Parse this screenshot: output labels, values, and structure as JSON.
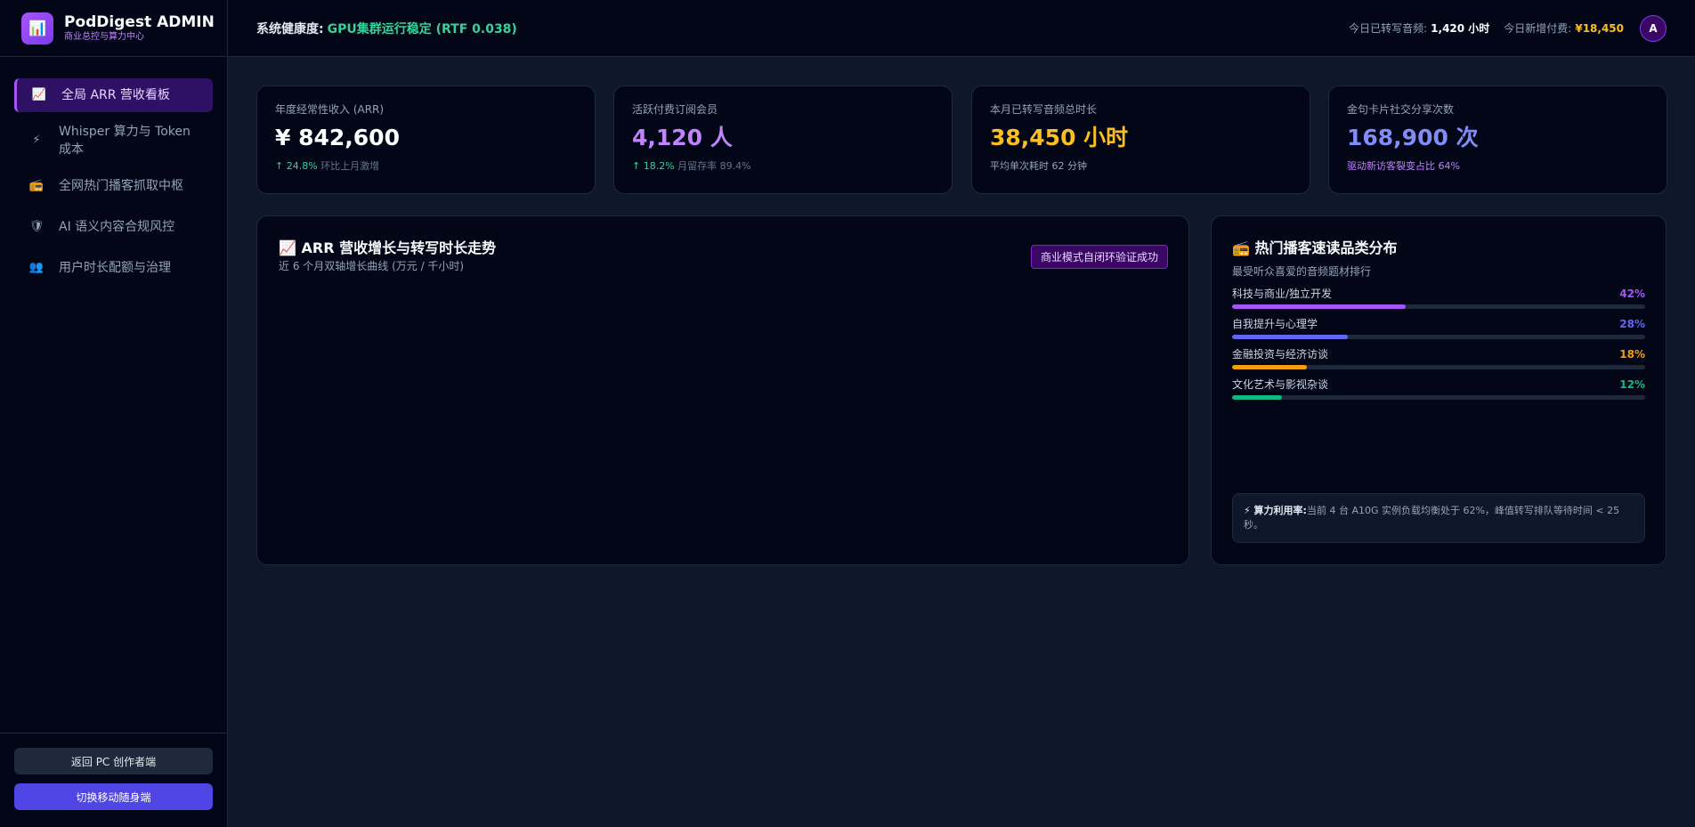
{
  "brand": {
    "logo_icon": "bar-chart-icon",
    "title": "PodDigest ADMIN",
    "subtitle": "商业总控与算力中心"
  },
  "nav": [
    {
      "icon": "chart-up-icon",
      "glyph": "📈",
      "label": "全局 ARR 营收看板",
      "active": true
    },
    {
      "icon": "lightning-icon",
      "glyph": "⚡",
      "label": "Whisper 算力与 Token 成本",
      "active": false
    },
    {
      "icon": "radio-icon",
      "glyph": "📻",
      "label": "全网热门播客抓取中枢",
      "active": false
    },
    {
      "icon": "shield-icon",
      "glyph": "🛡",
      "label": "AI 语义内容合规风控",
      "active": false
    },
    {
      "icon": "users-icon",
      "glyph": "👥",
      "label": "用户时长配额与治理",
      "active": false
    }
  ],
  "footer": {
    "back_label": "返回 PC 创作者端",
    "mobile_label": "切换移动随身端"
  },
  "topbar": {
    "health_label": "系统健康度:",
    "health_value": "GPU集群运行稳定 (RTF 0.038)",
    "today_transcribe_label": "今日已转写音频:",
    "today_transcribe_value": "1,420 小时",
    "today_pay_label": "今日新增付费:",
    "today_pay_value": "¥18,450",
    "avatar": "A"
  },
  "kpis": [
    {
      "label": "年度经常性收入 (ARR)",
      "value": "¥ 842,600",
      "color": "#ffffff",
      "foot_up": "↑ 24.8%",
      "foot_text": "环比上月激增"
    },
    {
      "label": "活跃付费订阅会员",
      "value": "4,120 人",
      "color": "#c084fc",
      "foot_up": "↑ 18.2%",
      "foot_text": "月留存率 89.4%"
    },
    {
      "label": "本月已转写音频总时长",
      "value": "38,450 小时",
      "color": "#fbbf24",
      "foot_up": "",
      "foot_text": "平均单次耗时 62 分钟"
    },
    {
      "label": "金句卡片社交分享次数",
      "value": "168,900 次",
      "color": "#818cf8",
      "foot_up": "",
      "foot_text": "驱动新访客裂变占比 64%"
    }
  ],
  "trend_panel": {
    "icon": "chart-up-icon",
    "title": "📈 ARR 营收增长与转写时长走势",
    "subtitle": "近 6 个月双轴增长曲线 (万元 / 千小时)",
    "badge": "商业模式自闭环验证成功"
  },
  "category_panel": {
    "icon": "radio-icon",
    "title": "📻 热门播客速读品类分布",
    "subtitle": "最受听众喜爱的音频题材排行",
    "items": [
      {
        "label": "科技与商业/独立开发",
        "pct": "42%",
        "value": 42,
        "color": "#a855f7"
      },
      {
        "label": "自我提升与心理学",
        "pct": "28%",
        "value": 28,
        "color": "#6366f1"
      },
      {
        "label": "金融投资与经济访谈",
        "pct": "18%",
        "value": 18,
        "color": "#f59e0b"
      },
      {
        "label": "文化艺术与影视杂谈",
        "pct": "12%",
        "value": 12,
        "color": "#10b981"
      }
    ],
    "note_icon": "lightning-icon",
    "note_title": "⚡ 算力利用率:",
    "note_text": "当前 4 台 A10G 实例负载均衡处于 62%，峰值转写排队等待时间 < 25 秒。"
  }
}
